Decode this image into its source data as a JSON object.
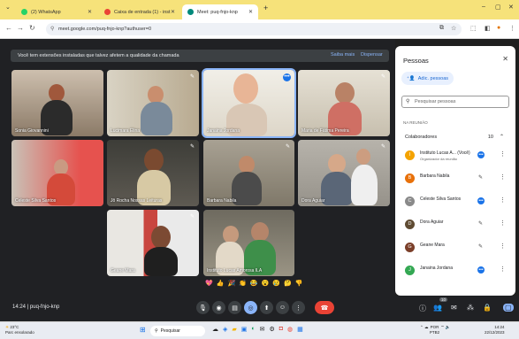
{
  "browser": {
    "tabs": [
      {
        "label": "(2) WhatsApp",
        "color": "#25d366"
      },
      {
        "label": "Caixa de entrada (1) - instituto",
        "color": "#ea4335"
      },
      {
        "label": "Meet: puq-fnjo-knp",
        "color": "#00897b"
      }
    ],
    "new_tab": "+",
    "url": "meet.google.com/puq-fnjo-knp?authuser=0"
  },
  "banner": {
    "text": "Você tem extensões instaladas que talvez afetem a qualidade da chamada",
    "learn_more": "Saiba mais",
    "dismiss": "Dispensar"
  },
  "tiles": [
    {
      "name": "Sonia Giovannini",
      "mic": "✎"
    },
    {
      "name": "Lucimara Elina",
      "mic": "✎"
    },
    {
      "name": "Janaina Jordana",
      "mic": "•••"
    },
    {
      "name": "Maria de Fátima Pereira",
      "mic": "✎"
    },
    {
      "name": "Celeste Silva Santos",
      "mic": "✎"
    },
    {
      "name": "Jô Rocha Nossas Leituras",
      "mic": "✎"
    },
    {
      "name": "Barbara Nabila",
      "mic": "✎"
    },
    {
      "name": "Dora Aguiar",
      "mic": "✎"
    },
    {
      "name": "Geane Mara",
      "mic": "✎"
    },
    {
      "name": "Instituto Lucas Amorosa ILA",
      "mic": ""
    }
  ],
  "reactions": [
    "💖",
    "👍",
    "🎉",
    "👏",
    "😂",
    "😮",
    "😢",
    "🤔",
    "👎"
  ],
  "bottom": {
    "time": "14:24",
    "code": "puq-fnjo-knp",
    "participants_badge": "10"
  },
  "panel": {
    "title": "Pessoas",
    "add_button": "Adic. pessoas",
    "search_placeholder": "Pesquisar pessoas",
    "in_meeting": "NA REUNIÃO",
    "collaborators_label": "Colaboradores",
    "collaborators_count": "10",
    "people": [
      {
        "name": "Instituto Lucas A... (Você)",
        "role": "Organizador da reunião",
        "initial": "I",
        "color": "#f4a300"
      },
      {
        "name": "Barbara Nabila",
        "role": "",
        "initial": "B",
        "color": "#e8710a"
      },
      {
        "name": "Celeste Silva Santos",
        "role": "",
        "initial": "C",
        "color": "#8a8a8a"
      },
      {
        "name": "Dora Aguiar",
        "role": "",
        "initial": "D",
        "color": "#5f4b32"
      },
      {
        "name": "Geane Mara",
        "role": "",
        "initial": "G",
        "color": "#7b3f2a"
      },
      {
        "name": "Janaina Jordana",
        "role": "",
        "initial": "J",
        "color": "#34a853"
      }
    ]
  },
  "taskbar": {
    "weather_temp": "23°C",
    "weather_desc": "Parc ensolarado",
    "search": "Pesquisar",
    "lang": "POR",
    "lang2": "PTB2",
    "time": "14:24",
    "date": "22/12/2023"
  }
}
